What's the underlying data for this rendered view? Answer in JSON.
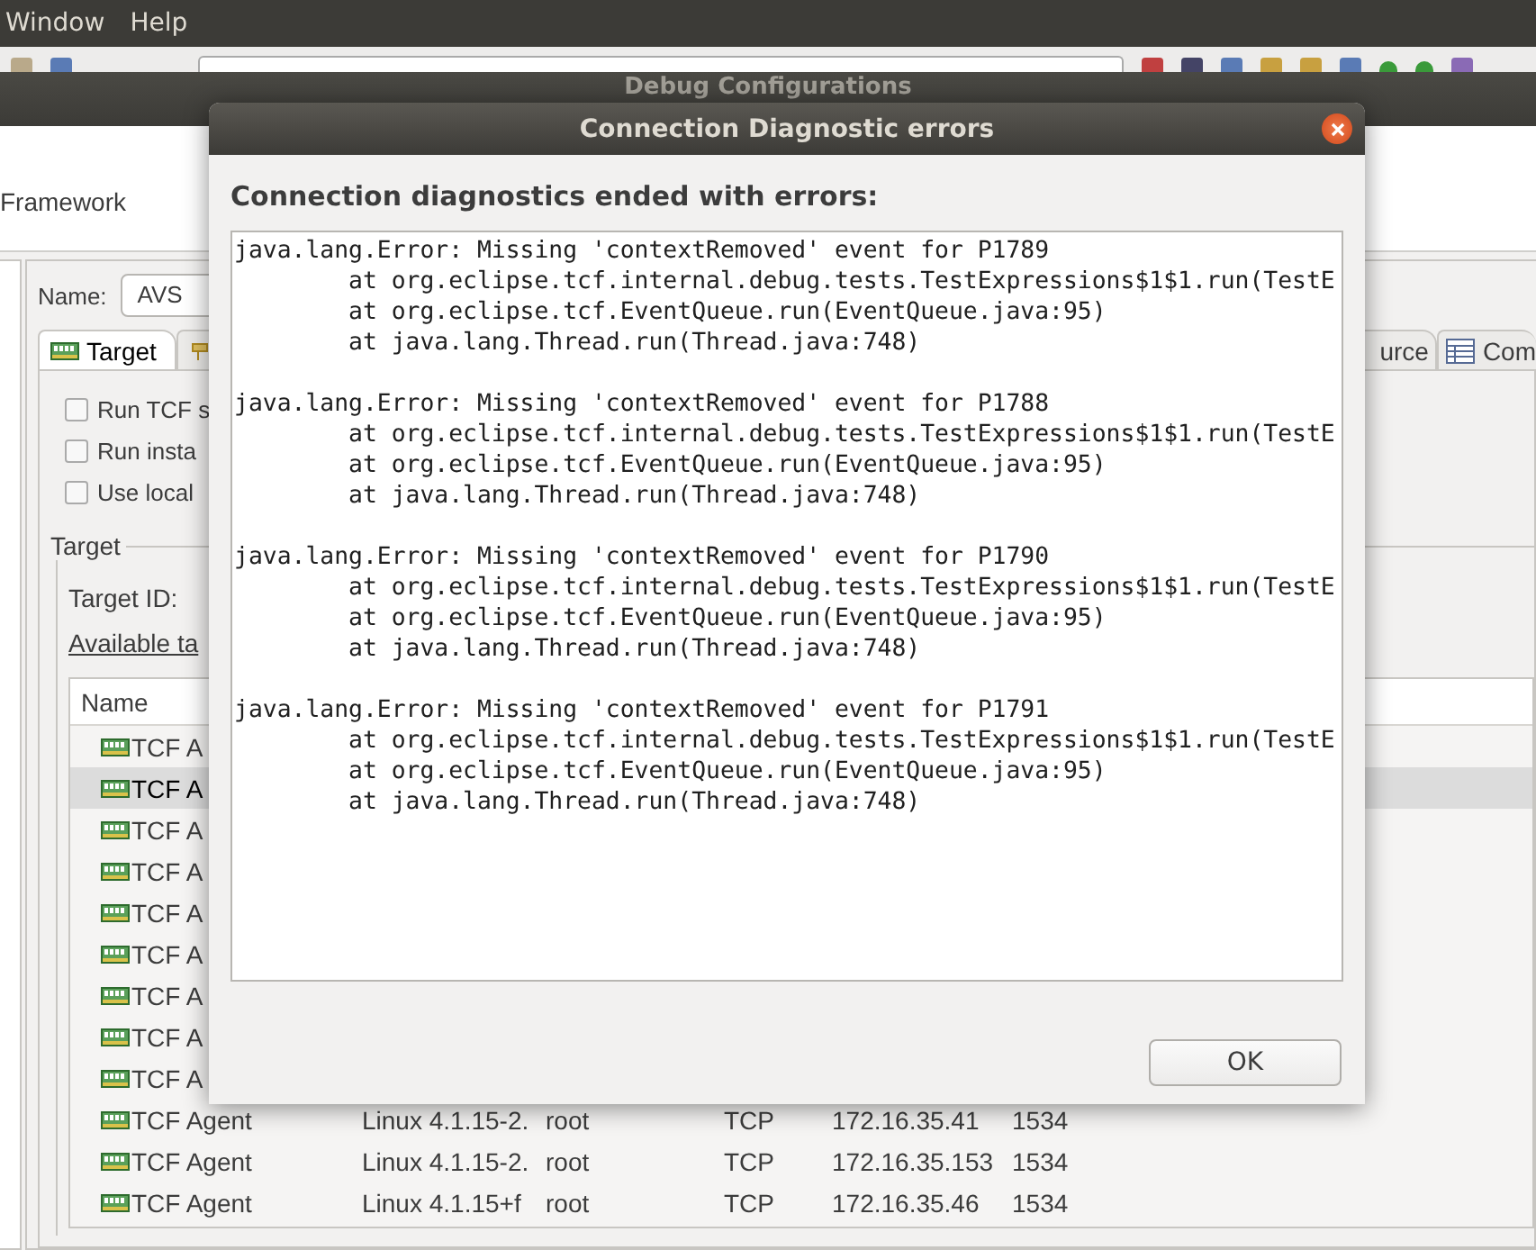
{
  "menubar": {
    "items": [
      "Window",
      "Help"
    ]
  },
  "debug_window": {
    "title": "Debug Configurations",
    "header": "Framework",
    "name_label": "Name:",
    "name_value": "AVS",
    "tabs": [
      {
        "kind": "text",
        "label": "Target",
        "selected": true
      },
      {
        "kind": "icon",
        "selected": false
      }
    ],
    "right_tabs": [
      {
        "label": "urce",
        "selected": false
      },
      {
        "label": "Com",
        "selected": false
      }
    ],
    "checkboxes": [
      {
        "label": "Run TCF s",
        "checked": false
      },
      {
        "label": "Run insta",
        "checked": false
      },
      {
        "label": "Use local",
        "checked": false
      }
    ],
    "target_group": {
      "legend": "Target",
      "target_id_label": "Target ID:",
      "available_label": "Available ta"
    },
    "table": {
      "columns": [
        "Name"
      ],
      "rows": [
        {
          "cells": [
            "TCF A"
          ],
          "selected": false
        },
        {
          "cells": [
            "TCF A"
          ],
          "selected": true
        },
        {
          "cells": [
            "TCF A"
          ],
          "selected": false
        },
        {
          "cells": [
            "TCF A"
          ],
          "selected": false
        },
        {
          "cells": [
            "TCF A"
          ],
          "selected": false
        },
        {
          "cells": [
            "TCF A"
          ],
          "selected": false
        },
        {
          "cells": [
            "TCF A"
          ],
          "selected": false
        },
        {
          "cells": [
            "TCF A"
          ],
          "selected": false
        },
        {
          "cells": [
            "TCF A"
          ],
          "selected": false
        },
        {
          "cells": [
            "TCF Agent",
            "Linux 4.1.15-2.",
            "root",
            "TCP",
            "172.16.35.41",
            "1534"
          ],
          "selected": false
        },
        {
          "cells": [
            "TCF Agent",
            "Linux 4.1.15-2.",
            "root",
            "TCP",
            "172.16.35.153",
            "1534"
          ],
          "selected": false
        },
        {
          "cells": [
            "TCF Agent",
            "Linux 4.1.15+f",
            "root",
            "TCP",
            "172.16.35.46",
            "1534"
          ],
          "selected": false
        }
      ]
    }
  },
  "dialog": {
    "title": "Connection Diagnostic errors",
    "heading": "Connection diagnostics ended with errors:",
    "errors": [
      {
        "message": "java.lang.Error: Missing 'contextRemoved' event for P1789",
        "frames": [
          "at org.eclipse.tcf.internal.debug.tests.TestExpressions$1$1.run(TestE",
          "at org.eclipse.tcf.EventQueue.run(EventQueue.java:95)",
          "at java.lang.Thread.run(Thread.java:748)"
        ]
      },
      {
        "message": "java.lang.Error: Missing 'contextRemoved' event for P1788",
        "frames": [
          "at org.eclipse.tcf.internal.debug.tests.TestExpressions$1$1.run(TestE",
          "at org.eclipse.tcf.EventQueue.run(EventQueue.java:95)",
          "at java.lang.Thread.run(Thread.java:748)"
        ]
      },
      {
        "message": "java.lang.Error: Missing 'contextRemoved' event for P1790",
        "frames": [
          "at org.eclipse.tcf.internal.debug.tests.TestExpressions$1$1.run(TestE",
          "at org.eclipse.tcf.EventQueue.run(EventQueue.java:95)",
          "at java.lang.Thread.run(Thread.java:748)"
        ]
      },
      {
        "message": "java.lang.Error: Missing 'contextRemoved' event for P1791",
        "frames": [
          "at org.eclipse.tcf.internal.debug.tests.TestExpressions$1$1.run(TestE",
          "at org.eclipse.tcf.EventQueue.run(EventQueue.java:95)",
          "at java.lang.Thread.run(Thread.java:748)"
        ]
      }
    ],
    "buttons": [
      "OK"
    ]
  }
}
